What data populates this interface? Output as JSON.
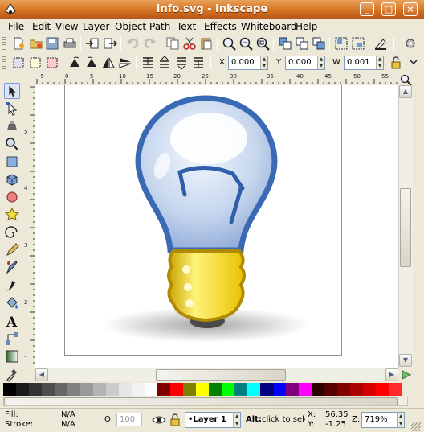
{
  "window": {
    "title": "info.svg - Inkscape"
  },
  "menu": [
    "File",
    "Edit",
    "View",
    "Layer",
    "Object",
    "Path",
    "Text",
    "Effects",
    "Whiteboard",
    "Help"
  ],
  "toolbar2": {
    "x_label": "X",
    "x_value": "0.000",
    "y_label": "Y",
    "y_value": "0.000",
    "w_label": "W",
    "w_value": "0.001"
  },
  "hruler_ticks": [
    "-5",
    "0",
    "5",
    "10",
    "15",
    "20",
    "25",
    "30",
    "35",
    "40",
    "45",
    "50",
    "55"
  ],
  "vruler_ticks": [
    "5",
    "4",
    "3",
    "2",
    "1"
  ],
  "palette": [
    "#000000",
    "#1a1a1a",
    "#333333",
    "#4d4d4d",
    "#666666",
    "#808080",
    "#999999",
    "#b3b3b3",
    "#cccccc",
    "#e6e6e6",
    "#f2f2f2",
    "#ffffff",
    "#800000",
    "#ff0000",
    "#808000",
    "#ffff00",
    "#008000",
    "#00ff00",
    "#008080",
    "#00ffff",
    "#000080",
    "#0000ff",
    "#800080",
    "#ff00ff",
    "#2b0000",
    "#550000",
    "#800000",
    "#aa0000",
    "#d40000",
    "#ff0000",
    "#ff2a2a"
  ],
  "status": {
    "fill_label": "Fill:",
    "fill_value": "N/A",
    "stroke_label": "Stroke:",
    "stroke_value": "N/A",
    "opacity_label": "O:",
    "opacity_value": "100",
    "layer_value": "•Layer 1",
    "message_bold": "Alt:",
    "message": " click to sele",
    "x_label": "X:",
    "x_value": "56.35",
    "y_label": "Y:",
    "y_value": "-1.25",
    "zoom_label": "Z:",
    "zoom_value": "719%"
  },
  "colors": {
    "titlebar": "#d2711f",
    "bulb_glass": "#3a6ab4",
    "base": "#f0d020"
  }
}
